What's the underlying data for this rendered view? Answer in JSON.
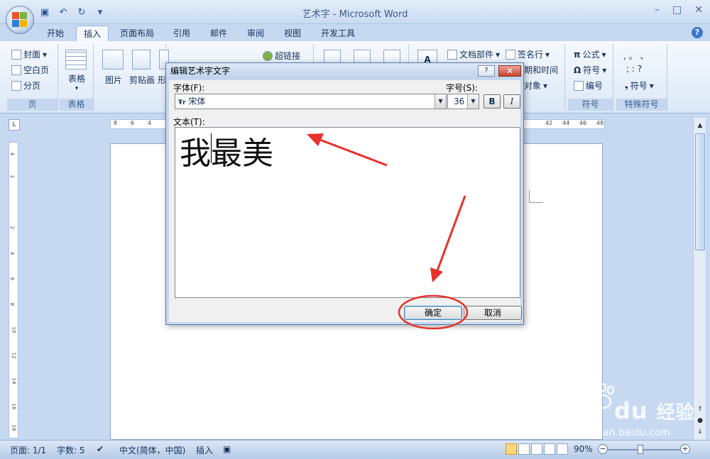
{
  "window": {
    "title": "艺术字 - Microsoft Word",
    "controls": [
      "–",
      "□",
      "✕"
    ]
  },
  "tabs": [
    "开始",
    "插入",
    "页面布局",
    "引用",
    "邮件",
    "审阅",
    "视图",
    "开发工具"
  ],
  "active_tab": "插入",
  "ribbon": {
    "pages": {
      "items": [
        "封面",
        "空白页",
        "分页"
      ],
      "label": "页"
    },
    "tables": {
      "item": "表格",
      "label": "表格"
    },
    "illustrations": {
      "items": [
        "图片",
        "剪贴画",
        "形"
      ]
    },
    "links": {
      "item": "超链接"
    },
    "text": {
      "items": [
        "文档部件",
        "签名行",
        "期和时间",
        "对象"
      ]
    },
    "symbols": {
      "items": [
        "公式",
        "符号",
        "编号"
      ],
      "label": "符号"
    },
    "special": {
      "row1": ",  。 、",
      "row2": ";  :  ?",
      "item": "符号",
      "label": "特殊符号"
    }
  },
  "ruler": {
    "left_nums": [
      "8",
      "6",
      "4"
    ],
    "right_nums": [
      "42",
      "44",
      "46",
      "48"
    ],
    "vertical_nums": [
      "4",
      "2",
      "2",
      "4",
      "6",
      "8",
      "10",
      "12",
      "14",
      "16",
      "18"
    ]
  },
  "dialog": {
    "title": "编辑艺术字文字",
    "help": "?",
    "close": "✕",
    "font_label": "字体(F):",
    "font_value": "宋体",
    "size_label": "字号(S):",
    "size_value": "36",
    "bold": "B",
    "italic": "I",
    "text_label": "文本(T):",
    "text_value": "我最美",
    "ok": "确定",
    "cancel": "取消"
  },
  "status": {
    "page": "页面: 1/1",
    "words": "字数: 5",
    "language": "中文(简体，中国)",
    "mode": "插入",
    "zoom": "90%"
  },
  "watermark": {
    "brand": "Bai",
    "brand2": "du",
    "cn": "经验",
    "url": "jingyan.baidu.com"
  },
  "colors": {
    "accent": "#e8312a",
    "ribbon": "#dbe8f7",
    "frame": "#c6d9f1"
  }
}
